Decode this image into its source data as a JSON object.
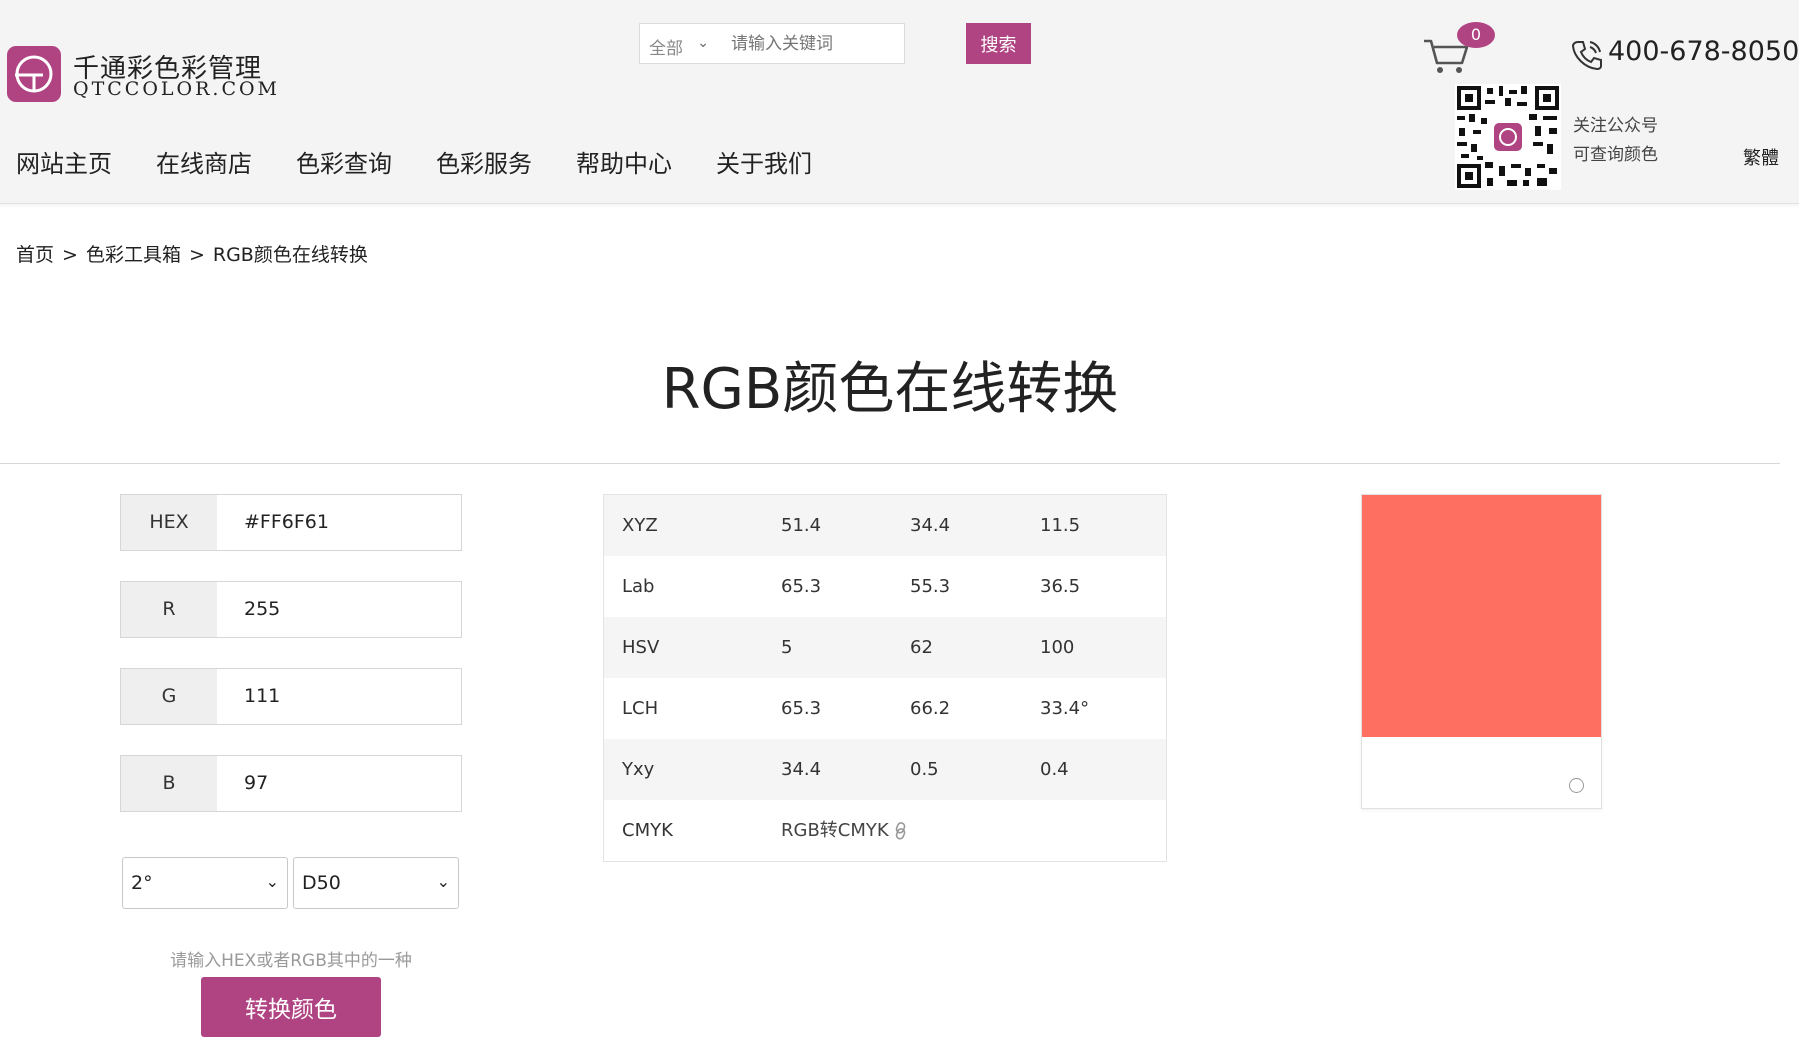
{
  "brand": {
    "name_cn": "千通彩色彩管理",
    "name_en": "QTCCOLOR.COM",
    "accent": "#b04482"
  },
  "search": {
    "category": "全部",
    "placeholder": "请输入关键词",
    "button_label": "搜索"
  },
  "nav": [
    "网站主页",
    "在线商店",
    "色彩查询",
    "色彩服务",
    "帮助中心",
    "关于我们"
  ],
  "cart": {
    "count": "0",
    "icon": "cart-icon"
  },
  "phone": {
    "number": "400-678-8050",
    "icon": "phone-icon"
  },
  "wechat": {
    "line1": "关注公众号",
    "line2": "可查询颜色"
  },
  "lang_toggle": "繁體",
  "breadcrumb": {
    "home": "首页",
    "sep": ">",
    "toolbox": "色彩工具箱",
    "current": "RGB颜色在线转换"
  },
  "page_title": "RGB颜色在线转换",
  "inputs": {
    "hex": {
      "label": "HEX",
      "value": "#FF6F61"
    },
    "r": {
      "label": "R",
      "value": "255"
    },
    "g": {
      "label": "G",
      "value": "111"
    },
    "b": {
      "label": "B",
      "value": "97"
    }
  },
  "observer": {
    "selected": "2°"
  },
  "illuminant": {
    "selected": "D50"
  },
  "hint": "请输入HEX或者RGB其中的一种",
  "convert_label": "转换颜色",
  "results": [
    {
      "name": "XYZ",
      "v1": "51.4",
      "v2": "34.4",
      "v3": "11.5"
    },
    {
      "name": "Lab",
      "v1": "65.3",
      "v2": "55.3",
      "v3": "36.5"
    },
    {
      "name": "HSV",
      "v1": "5",
      "v2": "62",
      "v3": "100"
    },
    {
      "name": "LCH",
      "v1": "65.3",
      "v2": "66.2",
      "v3": "33.4°"
    },
    {
      "name": "Yxy",
      "v1": "34.4",
      "v2": "0.5",
      "v3": "0.4"
    }
  ],
  "cmyk": {
    "name": "CMYK",
    "link": "RGB转CMYK"
  },
  "swatch": {
    "color": "#FF6F61"
  }
}
